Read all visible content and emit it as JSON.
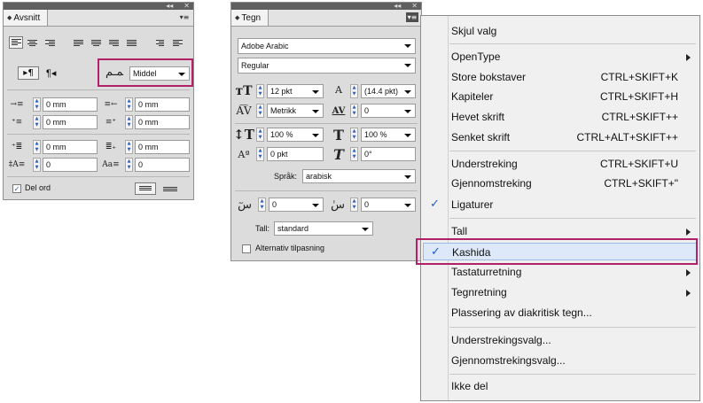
{
  "paragraph_panel": {
    "tab_label": "Avsnitt",
    "collapse_glyph": "◂◂",
    "close_glyph": "✕",
    "menu_glyph": "▾≡",
    "kashida_value": "Middel",
    "left_indent": "0 mm",
    "right_indent": "0 mm",
    "first_line_indent": "0 mm",
    "last_line_indent": "0 mm",
    "space_before": "0 mm",
    "space_after": "0 mm",
    "drop_cap_lines": "0",
    "drop_cap_chars": "0",
    "hyphenate_label": "Del ord",
    "hyphenate_checked": "✓",
    "pilcrow_rtl": "▸¶",
    "pilcrow_ltr": "¶◂"
  },
  "character_panel": {
    "tab_label": "Tegn",
    "collapse_glyph": "◂◂",
    "close_glyph": "✕",
    "menu_glyph": "▾≡",
    "font_family": "Adobe Arabic",
    "font_style": "Regular",
    "font_size": "12 pkt",
    "leading": "(14.4 pkt)",
    "kerning": "Metrikk",
    "tracking": "0",
    "vertical_scale": "100 %",
    "horizontal_scale": "100 %",
    "baseline_shift": "0 pkt",
    "skew": "0°",
    "language_label": "Språk:",
    "language_value": "arabisk",
    "diacritic_x": "0",
    "diacritic_y": "0",
    "digits_label": "Tall:",
    "digits_value": "standard",
    "alt_label": "Alternativ tilpasning"
  },
  "menu": {
    "items": [
      {
        "label": "Skjul valg",
        "shortcut": "",
        "checked": "",
        "submenu": false
      },
      {
        "label": "OpenType",
        "shortcut": "",
        "checked": "",
        "submenu": true
      },
      {
        "label": "Store bokstaver",
        "shortcut": "CTRL+SKIFT+K",
        "checked": "",
        "submenu": false
      },
      {
        "label": "Kapiteler",
        "shortcut": "CTRL+SKIFT+H",
        "checked": "",
        "submenu": false
      },
      {
        "label": "Hevet skrift",
        "shortcut": "CTRL+SKIFT++",
        "checked": "",
        "submenu": false
      },
      {
        "label": "Senket skrift",
        "shortcut": "CTRL+ALT+SKIFT++",
        "checked": "",
        "submenu": false
      },
      {
        "label": "Understreking",
        "shortcut": "CTRL+SKIFT+U",
        "checked": "",
        "submenu": false
      },
      {
        "label": "Gjennomstreking",
        "shortcut": "CTRL+SKIFT+\"",
        "checked": "",
        "submenu": false
      },
      {
        "label": "Ligaturer",
        "shortcut": "",
        "checked": "✓",
        "submenu": false
      },
      {
        "label": "Tall",
        "shortcut": "",
        "checked": "",
        "submenu": true
      },
      {
        "label": "Kashida",
        "shortcut": "",
        "checked": "✓",
        "submenu": false
      },
      {
        "label": "Tastaturretning",
        "shortcut": "",
        "checked": "",
        "submenu": true
      },
      {
        "label": "Tegnretning",
        "shortcut": "",
        "checked": "",
        "submenu": true
      },
      {
        "label": "Plassering av diakritisk tegn...",
        "shortcut": "",
        "checked": "",
        "submenu": false
      },
      {
        "label": "Understrekingsvalg...",
        "shortcut": "",
        "checked": "",
        "submenu": false
      },
      {
        "label": "Gjennomstrekingsvalg...",
        "shortcut": "",
        "checked": "",
        "submenu": false
      },
      {
        "label": "Ikke del",
        "shortcut": "",
        "checked": "",
        "submenu": false
      }
    ]
  },
  "colors": {
    "highlight_border": "#b3206a",
    "check_blue": "#1f5fc4",
    "menu_hover": "#dde8f8"
  }
}
